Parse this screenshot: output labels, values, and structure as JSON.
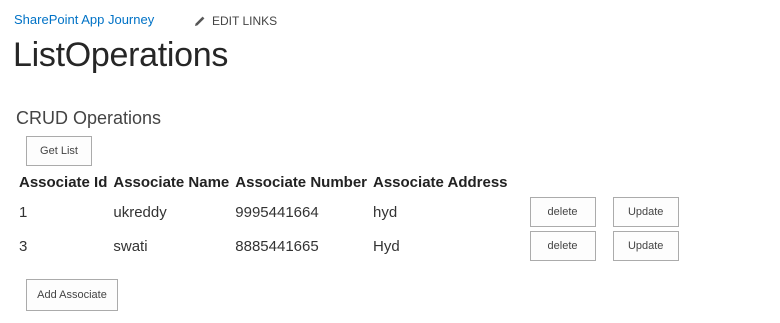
{
  "header": {
    "breadcrumb": "SharePoint App Journey",
    "edit_links_label": "EDIT LINKS",
    "edit_icon": "pencil-icon"
  },
  "page": {
    "title": "ListOperations",
    "section_heading": "CRUD Operations"
  },
  "buttons": {
    "get_list": "Get List",
    "add_associate": "Add Associate"
  },
  "table": {
    "columns": [
      "Associate Id",
      "Associate Name",
      "Associate Number",
      "Associate Address"
    ],
    "rows": [
      {
        "id": "1",
        "name": "ukreddy",
        "number": "9995441664",
        "address": "hyd",
        "delete_label": "delete",
        "update_label": "Update"
      },
      {
        "id": "3",
        "name": "swati",
        "number": "8885441665",
        "address": "Hyd",
        "delete_label": "delete",
        "update_label": "Update"
      }
    ]
  }
}
